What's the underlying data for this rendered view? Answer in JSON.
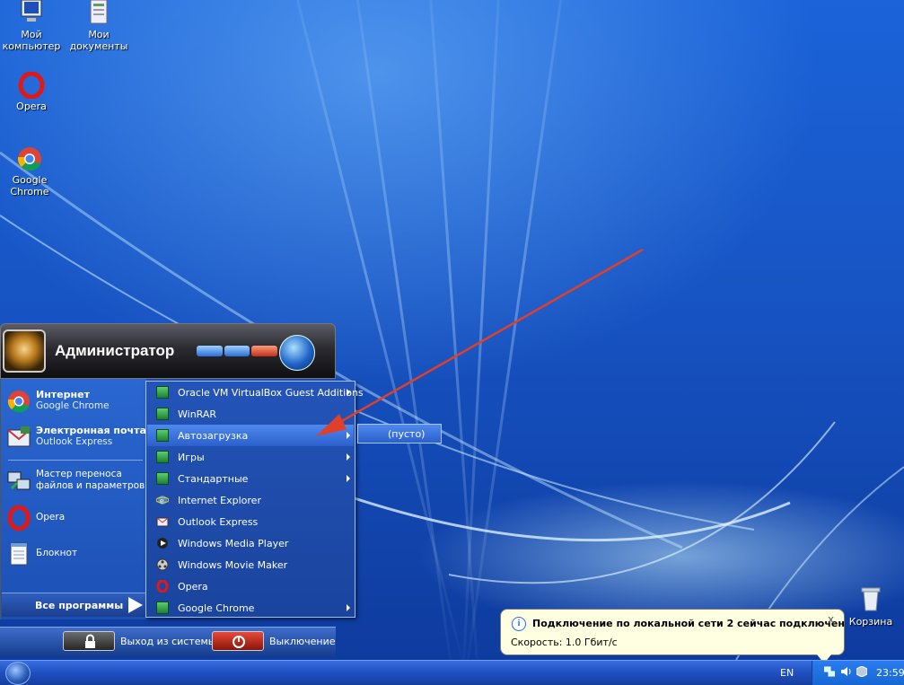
{
  "desktop": {
    "icons": [
      {
        "label_line1": "Мой",
        "label_line2": "компьютер",
        "icon": "my-computer-icon"
      },
      {
        "label_line1": "Мои",
        "label_line2": "документы",
        "icon": "my-documents-icon"
      },
      {
        "label": "Opera",
        "icon": "opera-icon"
      },
      {
        "label": "Google Chrome",
        "icon": "chrome-icon"
      },
      {
        "label": "Корзина",
        "icon": "recycle-bin-icon"
      }
    ]
  },
  "start_menu": {
    "user_name": "Администратор",
    "pinned": [
      {
        "title": "Интернет",
        "subtitle": "Google Chrome",
        "icon": "chrome-icon"
      },
      {
        "title": "Электронная почта",
        "subtitle": "Outlook Express",
        "icon": "outlook-express-icon"
      }
    ],
    "recent": [
      {
        "label": "Мастер переноса файлов и параметров",
        "icon": "migration-wizard-icon"
      },
      {
        "label": "Opera",
        "icon": "opera-icon"
      },
      {
        "label": "Блокнот",
        "icon": "notepad-icon"
      }
    ],
    "all_programs_label": "Все программы",
    "logoff_label": "Выход из системы",
    "shutdown_label": "Выключение"
  },
  "programs_menu": {
    "items": [
      {
        "label": "Oracle VM VirtualBox Guest Additions",
        "icon": "folder-icon",
        "submenu": true
      },
      {
        "label": "WinRAR",
        "icon": "folder-icon",
        "submenu": false
      },
      {
        "label": "Автозагрузка",
        "icon": "folder-icon",
        "submenu": true,
        "highlighted": true
      },
      {
        "label": "Игры",
        "icon": "folder-icon",
        "submenu": true
      },
      {
        "label": "Стандартные",
        "icon": "folder-icon",
        "submenu": true
      },
      {
        "label": "Internet Explorer",
        "icon": "internet-explorer-icon",
        "submenu": false
      },
      {
        "label": "Outlook Express",
        "icon": "outlook-express-icon",
        "submenu": false
      },
      {
        "label": "Windows Media Player",
        "icon": "media-player-icon",
        "submenu": false
      },
      {
        "label": "Windows Movie Maker",
        "icon": "movie-maker-icon",
        "submenu": false
      },
      {
        "label": "Opera",
        "icon": "opera-icon",
        "submenu": false
      },
      {
        "label": "Google Chrome",
        "icon": "folder-icon",
        "submenu": true
      }
    ]
  },
  "autorun_menu": {
    "label": "(пусто)"
  },
  "balloon": {
    "title": "Подключение по локальной сети 2 сейчас подключен",
    "body": "Скорость: 1.0 Гбит/с",
    "close": "x"
  },
  "taskbar": {
    "language": "EN",
    "clock": "23:59"
  },
  "colors": {
    "annotation_arrow": "#e0402a",
    "highlight": "#3d78e3",
    "balloon_bg": "#ffffe1"
  }
}
